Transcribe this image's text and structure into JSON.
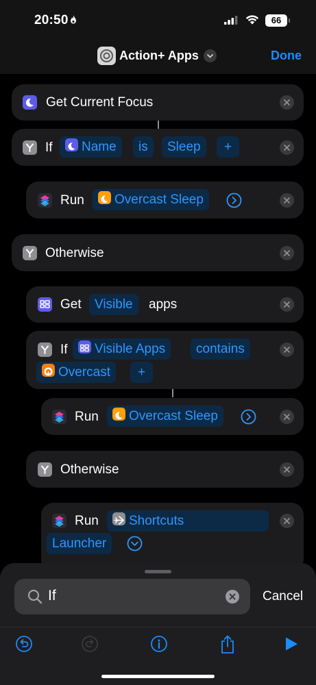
{
  "status": {
    "time": "20:50",
    "battery": "66"
  },
  "nav": {
    "title": "Action+ Apps",
    "done_label": "Done"
  },
  "actions": {
    "a1": {
      "label": "Get Current Focus"
    },
    "a2": {
      "keyword": "If",
      "token1": "Name",
      "token2": "is",
      "token3": "Sleep",
      "add": "+"
    },
    "a3": {
      "keyword": "Run",
      "token": "Overcast Sleep"
    },
    "a4": {
      "label": "Otherwise"
    },
    "a5": {
      "keyword": "Get",
      "token": "Visible",
      "suffix": "apps"
    },
    "a6": {
      "keyword": "If",
      "token1": "Visible Apps",
      "token2": "contains",
      "token3": "Overcast",
      "add": "+"
    },
    "a7": {
      "keyword": "Run",
      "token": "Overcast Sleep"
    },
    "a8": {
      "label": "Otherwise"
    },
    "a9": {
      "keyword": "Run",
      "token_line1": "Shortcuts",
      "token_line2": "Launcher"
    }
  },
  "search": {
    "value": "If",
    "cancel_label": "Cancel"
  },
  "icons": {
    "focus": "moon-icon",
    "if": "branch-icon",
    "run": "shortcuts-icon",
    "get": "app-grid-icon",
    "overcast": "overcast-icon",
    "launcher": "airplane-icon",
    "toolbar": [
      "undo-icon",
      "redo-icon",
      "info-icon",
      "share-icon",
      "play-icon"
    ]
  },
  "colors": {
    "accent": "#1a8cff",
    "token_bg": "#0c2a46",
    "focus_purple": "#5e5ce6",
    "overcast_orange": "#fc7e0f"
  }
}
